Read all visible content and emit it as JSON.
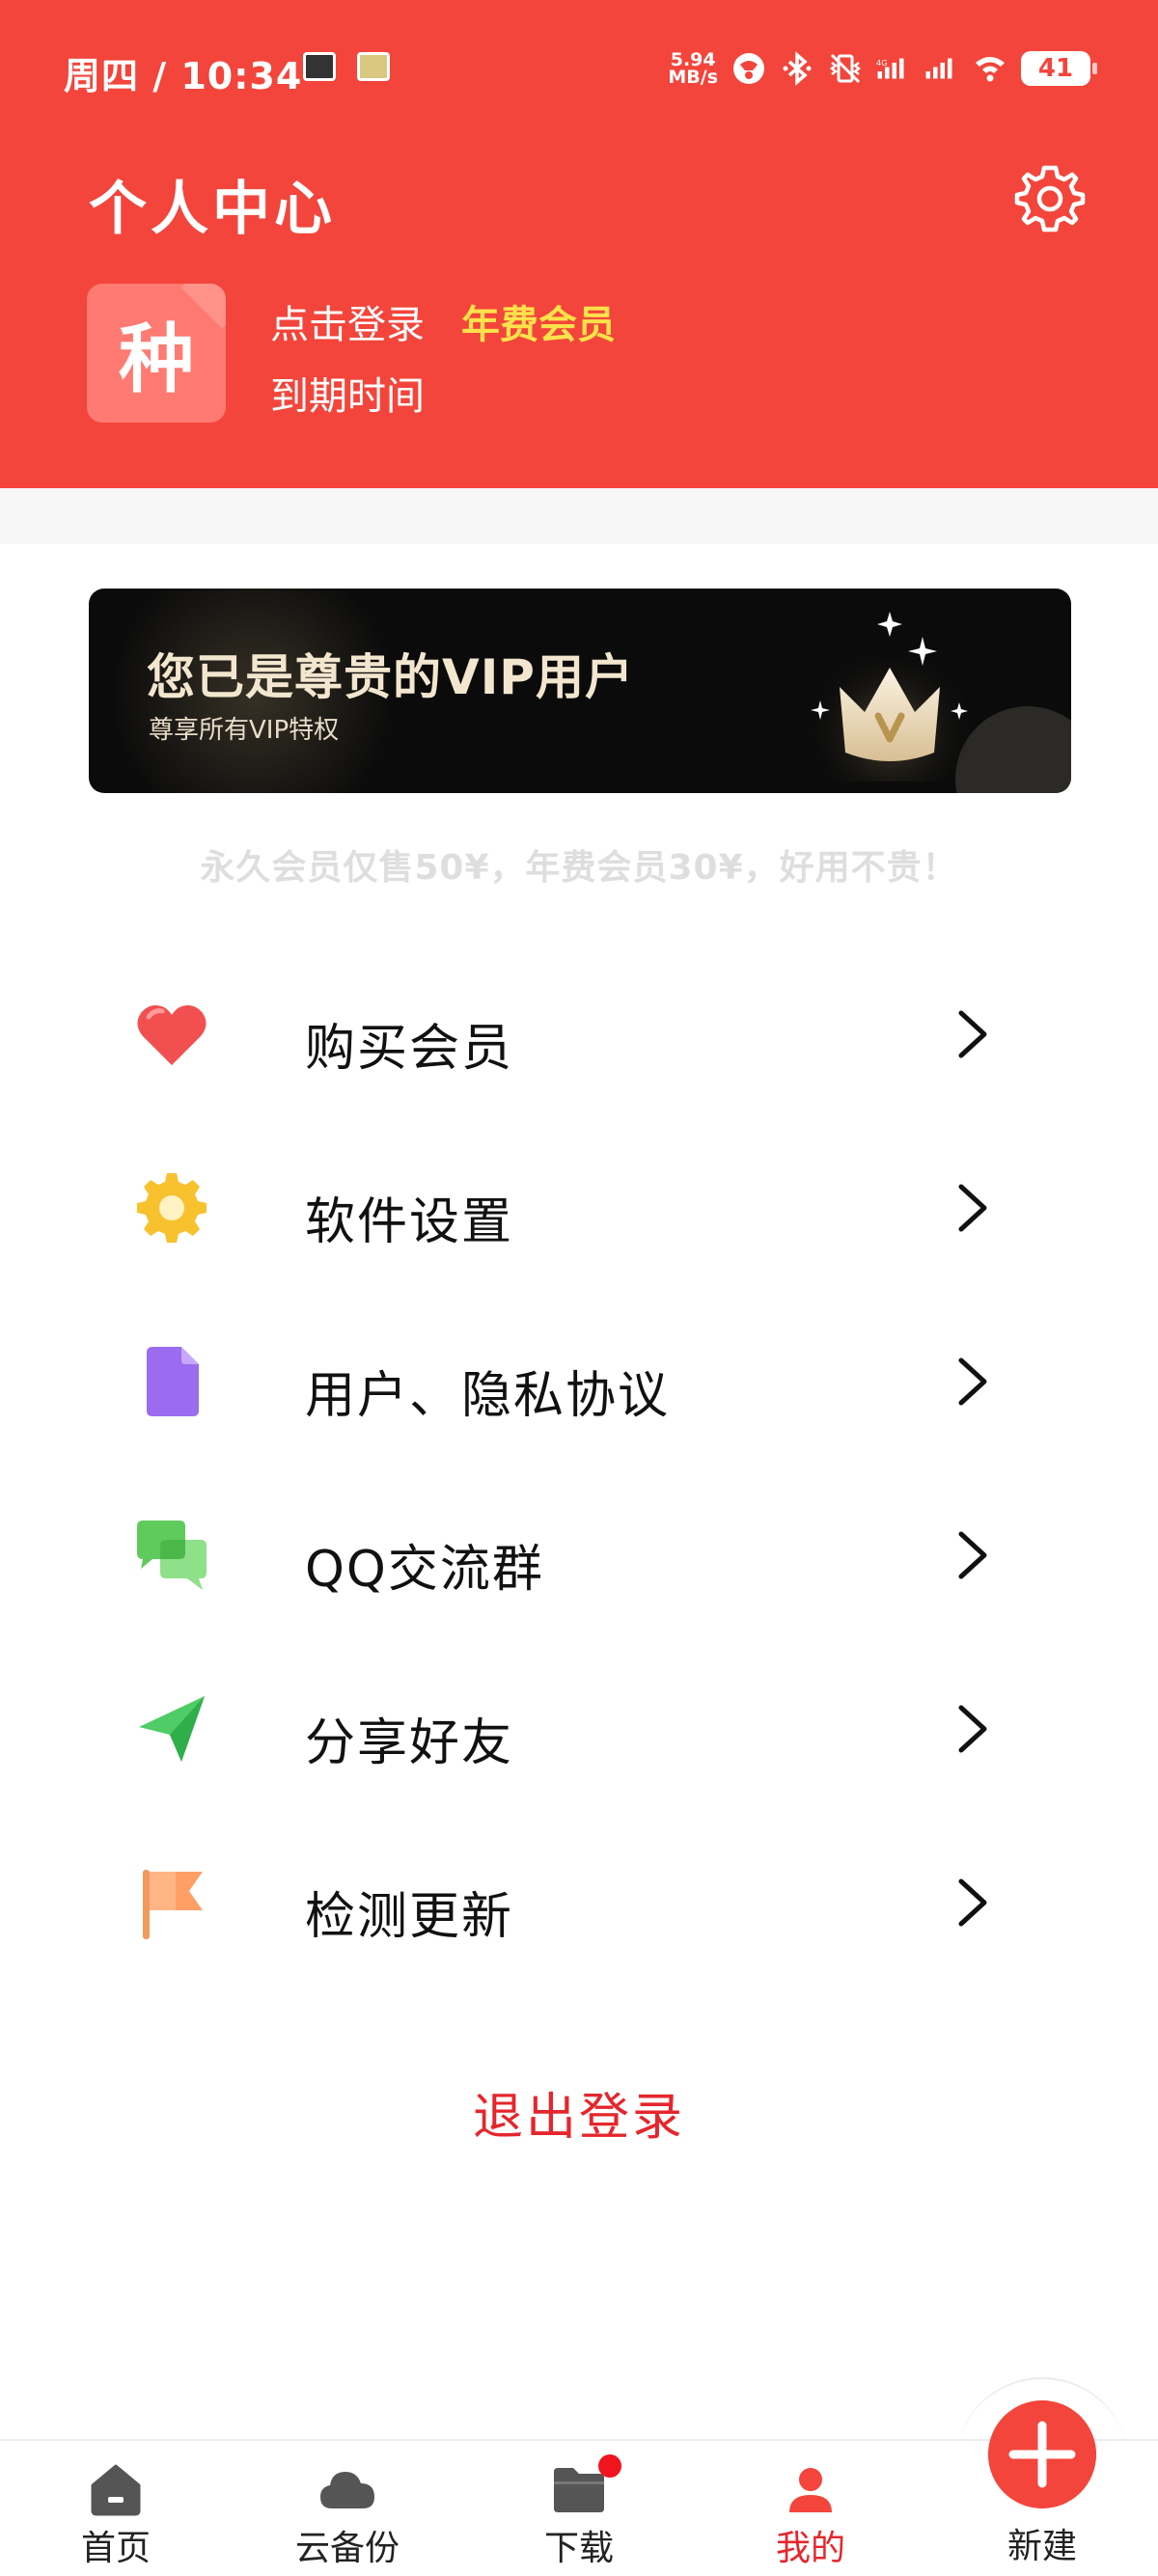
{
  "status_bar": {
    "time": "周四 / 10:34",
    "network_speed_value": "5.94",
    "network_speed_unit": "MB/s",
    "battery": "41"
  },
  "header": {
    "title": "个人中心",
    "login_text": "点击登录",
    "member_badge": "年费会员",
    "expire_label": "到期时间",
    "avatar_char": "种"
  },
  "vip_banner": {
    "title": "您已是尊贵的VIP用户",
    "subtitle": "尊享所有VIP特权",
    "crown_letter": "V"
  },
  "promo_text": "永久会员仅售50¥，年费会员30¥，好用不贵！",
  "menu": {
    "items": [
      {
        "label": "购买会员",
        "icon": "heart-icon"
      },
      {
        "label": "软件设置",
        "icon": "gear-icon"
      },
      {
        "label": "用户、隐私协议",
        "icon": "document-icon"
      },
      {
        "label": "QQ交流群",
        "icon": "chat-icon"
      },
      {
        "label": "分享好友",
        "icon": "send-icon"
      },
      {
        "label": "检测更新",
        "icon": "flag-icon"
      }
    ]
  },
  "logout_label": "退出登录",
  "bottom_nav": {
    "items": [
      {
        "label": "首页",
        "icon": "home-icon"
      },
      {
        "label": "云备份",
        "icon": "cloud-icon"
      },
      {
        "label": "下载",
        "icon": "folder-icon"
      },
      {
        "label": "我的",
        "icon": "user-icon"
      },
      {
        "label": "新建",
        "icon": "plus-icon"
      }
    ],
    "active_index": 3
  },
  "colors": {
    "brand_red": "#f3453b",
    "accent_yellow": "#ffe24a",
    "logout_red": "#e5262c"
  }
}
